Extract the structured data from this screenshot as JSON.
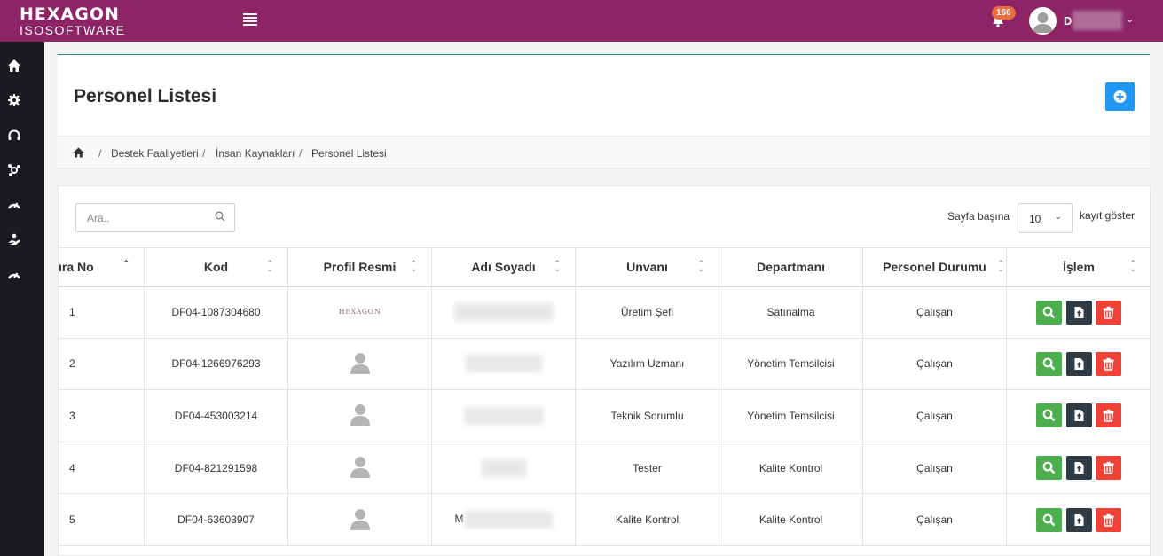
{
  "brand": {
    "line1": "HEXAGON",
    "line2": "ISOSOFTWARE"
  },
  "topbar": {
    "notification_count": "166",
    "user_initial": "D"
  },
  "sidebar": {
    "items": [
      {
        "icon": "home-icon"
      },
      {
        "icon": "gear-icon"
      },
      {
        "icon": "headset-icon"
      },
      {
        "icon": "network-icon"
      },
      {
        "icon": "gauge-icon"
      },
      {
        "icon": "hand-icon"
      },
      {
        "icon": "gauge-icon"
      }
    ]
  },
  "page": {
    "title": "Personel Listesi"
  },
  "breadcrumb": {
    "items": [
      "Destek Faaliyetleri",
      "İnsan Kaynakları",
      "Personel Listesi"
    ]
  },
  "controls": {
    "search_placeholder": "Ara..",
    "per_page_label": "Sayfa başına",
    "per_page_value": "10",
    "per_page_suffix": "kayıt göster"
  },
  "table": {
    "headers": [
      "ıra No",
      "Kod",
      "Profil Resmi",
      "Adı Soyadı",
      "Unvanı",
      "Departmanı",
      "Personel Durumu",
      "İşlem"
    ],
    "rows": [
      {
        "no": "1",
        "kod": "DF04-1087304680",
        "avatar": "logo",
        "ad": "",
        "unvan": "Üretim Şefi",
        "departman": "Satınalma",
        "durum": "Çalışan"
      },
      {
        "no": "2",
        "kod": "DF04-1266976293",
        "avatar": "person",
        "ad": "",
        "unvan": "Yazılım Uzmanı",
        "departman": "Yönetim Temsilcisi",
        "durum": "Çalışan"
      },
      {
        "no": "3",
        "kod": "DF04-453003214",
        "avatar": "person",
        "ad": "",
        "unvan": "Teknik Sorumlu",
        "departman": "Yönetim Temsilcisi",
        "durum": "Çalışan"
      },
      {
        "no": "4",
        "kod": "DF04-821291598",
        "avatar": "person",
        "ad": "",
        "unvan": "Tester",
        "departman": "Kalite Kontrol",
        "durum": "Çalışan"
      },
      {
        "no": "5",
        "kod": "DF04-63603907",
        "avatar": "person",
        "ad": "M",
        "unvan": "Kalite Kontrol",
        "departman": "Kalite Kontrol",
        "durum": "Çalışan"
      }
    ]
  },
  "colors": {
    "topbar": "#8c2465",
    "sidebar": "#1b1b1f",
    "view_button": "#4cae4c",
    "upload_button": "#2f3b45",
    "delete_button": "#ef4136",
    "add_button": "#2196f3",
    "badge": "#ef6b3c"
  }
}
